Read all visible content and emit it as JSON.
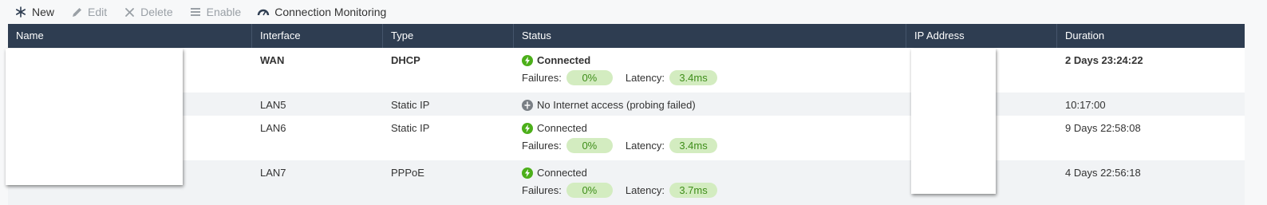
{
  "toolbar": {
    "buttons": [
      {
        "label": "New",
        "icon": "asterisk-icon",
        "enabled": true
      },
      {
        "label": "Edit",
        "icon": "pencil-icon",
        "enabled": false
      },
      {
        "label": "Delete",
        "icon": "x-icon",
        "enabled": false
      },
      {
        "label": "Enable",
        "icon": "list-icon",
        "enabled": false
      },
      {
        "label": "Connection Monitoring",
        "icon": "gauge-icon",
        "enabled": true
      }
    ]
  },
  "table": {
    "columns": [
      "Name",
      "Interface",
      "Type",
      "Status",
      "IP Address",
      "Duration"
    ],
    "rows": [
      {
        "interface": "WAN",
        "type": "DHCP",
        "status": "Connected",
        "failures_label": "Failures:",
        "failures": "0%",
        "latency_label": "Latency:",
        "latency": "3.4ms",
        "duration": "2 Days 23:24:22"
      },
      {
        "interface": "LAN5",
        "type": "Static IP",
        "status": "No Internet access (probing failed)",
        "duration": "10:17:00"
      },
      {
        "interface": "LAN6",
        "type": "Static IP",
        "status": "Connected",
        "failures_label": "Failures:",
        "failures": "0%",
        "latency_label": "Latency:",
        "latency": "3.4ms",
        "duration": "9 Days 22:58:08"
      },
      {
        "interface": "LAN7",
        "type": "PPPoE",
        "status": "Connected",
        "failures_label": "Failures:",
        "failures": "0%",
        "latency_label": "Latency:",
        "latency": "3.7ms",
        "duration": "4 Days 22:56:18"
      }
    ]
  },
  "colors": {
    "header_bg": "#2e3d51",
    "connected": "#4caf1a",
    "pill_bg": "#d3ecc0",
    "pill_text": "#3f8e1a",
    "no_internet": "#7a7f85"
  }
}
